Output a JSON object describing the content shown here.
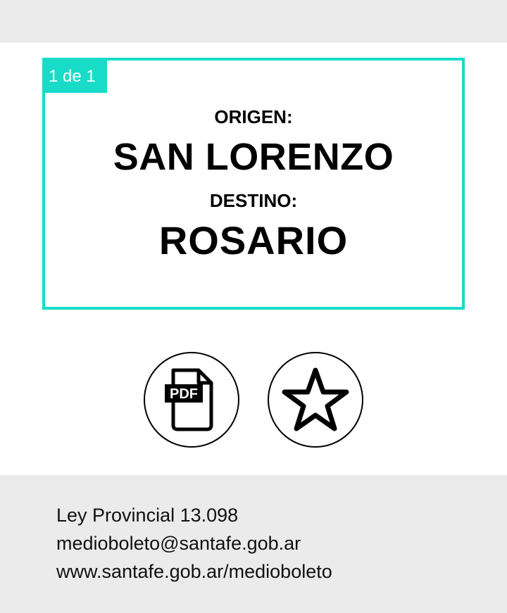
{
  "ticket": {
    "page_indicator": "1 de 1",
    "origin_label": "ORIGEN:",
    "origin": "SAN LORENZO",
    "destination_label": "DESTINO:",
    "destination": "ROSARIO"
  },
  "actions": {
    "pdf_icon": "pdf-file-icon",
    "pdf_text": "PDF",
    "favorite_icon": "star-outline-icon"
  },
  "footer": {
    "law": "Ley Provincial 13.098",
    "email": "medioboleto@santafe.gob.ar",
    "website": "www.santafe.gob.ar/medioboleto"
  },
  "colors": {
    "accent": "#18dcc8",
    "gray_bar": "#ebebeb"
  }
}
